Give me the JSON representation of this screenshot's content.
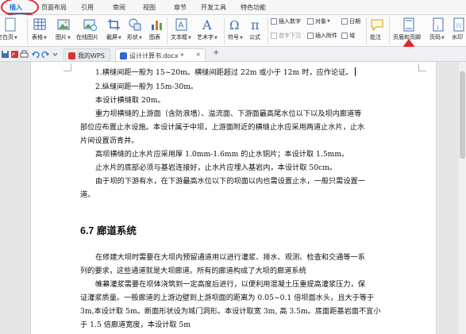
{
  "menu_tabs": [
    {
      "label": "插入",
      "active": true
    },
    {
      "label": "页面布局"
    },
    {
      "label": "引用"
    },
    {
      "label": "审阅"
    },
    {
      "label": "视图"
    },
    {
      "label": "章节"
    },
    {
      "label": "开发工具"
    },
    {
      "label": "特色功能"
    }
  ],
  "ribbon": {
    "blank_page": "空白页",
    "table": "表格",
    "picture": "图片",
    "online_picture": "在线图片",
    "screenshot": "截屏",
    "shape": "形状",
    "chart": "图表",
    "textbox": "文本框",
    "wordart": "艺术字",
    "symbol": "符号",
    "formula": "公式",
    "insert_number": "插入数字",
    "object": "对象",
    "date": "日期",
    "first_letter_sink": "首字下沉",
    "insert_attachment": "插入附件",
    "field": "域",
    "comment": "批注",
    "header_footer": "页眉和页脚",
    "page_number": "页码",
    "watermark": "水印"
  },
  "docbar": {
    "tabs": [
      {
        "label": "我的WPS",
        "active": false
      },
      {
        "label": "设计计算书.docx *",
        "active": true
      }
    ],
    "close_symbol": "×",
    "new_tab_symbol": "+"
  },
  "document": {
    "lines": [
      "1.横缝间距一般为 15~20m。横缝间距超过 22m 或小于 12m 时，应作论证。",
      "2.纵缝间距一般为 15m-30m。",
      "本设计横缝取 20m。",
      "重力坝横缝的上游面（含防浪墙）、溢流面、下游面最高尾水位以下以及坝内廊道等",
      "部位应布置止水设施。本设计属于中坝，上游面附近的横缝止水应采用两道止水片，止水",
      "片间设置沥青井。",
      "高坝横缝的止水片应采用厚 1.0mm-1.6mm 的止水铜片；本设计取 1.5mm。",
      "止水片的底部必须与基岩连接好，止水片应埋入基岩内，本设计取 50cm。",
      "由于坝的下游有水，在下游最高水位以下的坝面以内也需设置止水，一般只需设置一",
      "道。"
    ],
    "heading": "6.7 廊道系统",
    "lines2": [
      "在修建大坝时需要在大坝内预留通道用以进行灌浆、排水、观测、检查和交通等一系",
      "列的要求，这些通道就是大坝廊道。所有的廊道构成了大坝的廊道系统",
      "帷幕灌浆需要在坝体浇筑到一定高度后进行，以便利用混凝土压重提高灌浆压力，保",
      "证灌浆质量。一般廊道的上游边壁到上游坝面的距离为 0.05~0.1 倍坝面水头，且大于等于",
      "3m,本设计取 5m。断面形状设为城门洞形。本设计取宽 3m, 高 3.5m。底面距基岩面不宜小",
      "于 1.5 倍廊道宽度，本设计取 5m"
    ]
  },
  "colors": {
    "accent": "#1f6fd1",
    "annotation_red": "#e3262b"
  }
}
